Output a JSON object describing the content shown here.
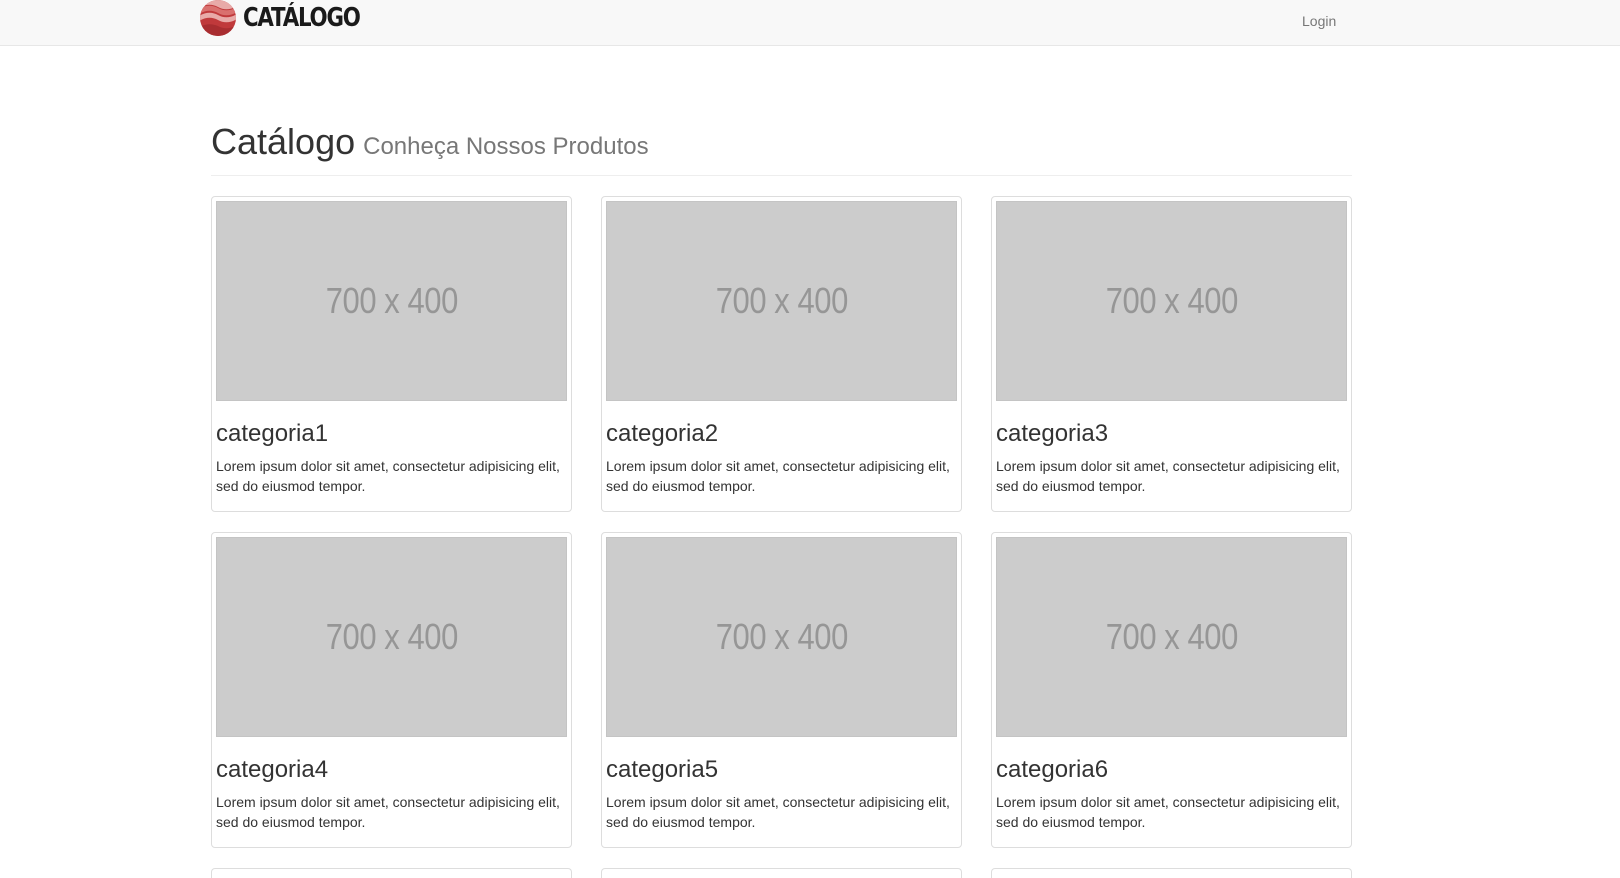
{
  "navbar": {
    "brand": "CATÁLOGO",
    "login_label": "Login"
  },
  "header": {
    "title": "Catálogo",
    "subtitle": "Conheça Nossos Produtos"
  },
  "cards": [
    {
      "image_label": "700 x 400",
      "title": "categoria1",
      "description": "Lorem ipsum dolor sit amet, consectetur adipisicing elit, sed do eiusmod tempor."
    },
    {
      "image_label": "700 x 400",
      "title": "categoria2",
      "description": "Lorem ipsum dolor sit amet, consectetur adipisicing elit, sed do eiusmod tempor."
    },
    {
      "image_label": "700 x 400",
      "title": "categoria3",
      "description": "Lorem ipsum dolor sit amet, consectetur adipisicing elit, sed do eiusmod tempor."
    },
    {
      "image_label": "700 x 400",
      "title": "categoria4",
      "description": "Lorem ipsum dolor sit amet, consectetur adipisicing elit, sed do eiusmod tempor."
    },
    {
      "image_label": "700 x 400",
      "title": "categoria5",
      "description": "Lorem ipsum dolor sit amet, consectetur adipisicing elit, sed do eiusmod tempor."
    },
    {
      "image_label": "700 x 400",
      "title": "categoria6",
      "description": "Lorem ipsum dolor sit amet, consectetur adipisicing elit, sed do eiusmod tempor."
    }
  ],
  "colors": {
    "navbar_bg": "#f8f8f8",
    "logo_red": "#c0393b",
    "placeholder_bg": "#cccccc"
  }
}
